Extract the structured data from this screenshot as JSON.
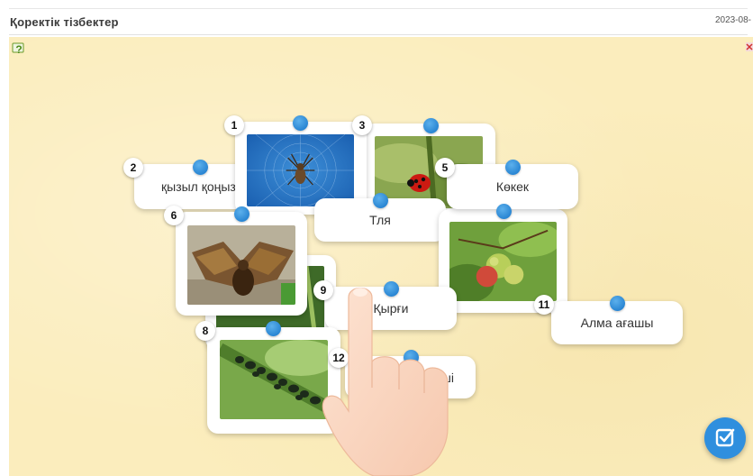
{
  "header": {
    "title": "Қоректік тізбектер",
    "date": "2023-08-"
  },
  "icons": {
    "help": "help-question-icon",
    "corner": "close-marker-icon",
    "check": "check-edit-icon"
  },
  "colors": {
    "board_bg": "#fbedbd",
    "accent": "#2f8fde",
    "dot": "#2a86d3"
  },
  "cards": {
    "c1": {
      "number": "1"
    },
    "c2": {
      "number": "2",
      "label": "қызыл қоңыз"
    },
    "c3": {
      "number": "3"
    },
    "c5": {
      "number": "5",
      "label": "Көкек"
    },
    "c6": {
      "number": "6"
    },
    "c8": {
      "number": "8"
    },
    "c9": {
      "number": "9",
      "label": "Қырғи"
    },
    "c11": {
      "number": "11",
      "label": "Алма ағашы"
    },
    "c12": {
      "number": "12",
      "label": "екші"
    },
    "tlya": {
      "label": "Тля"
    }
  }
}
